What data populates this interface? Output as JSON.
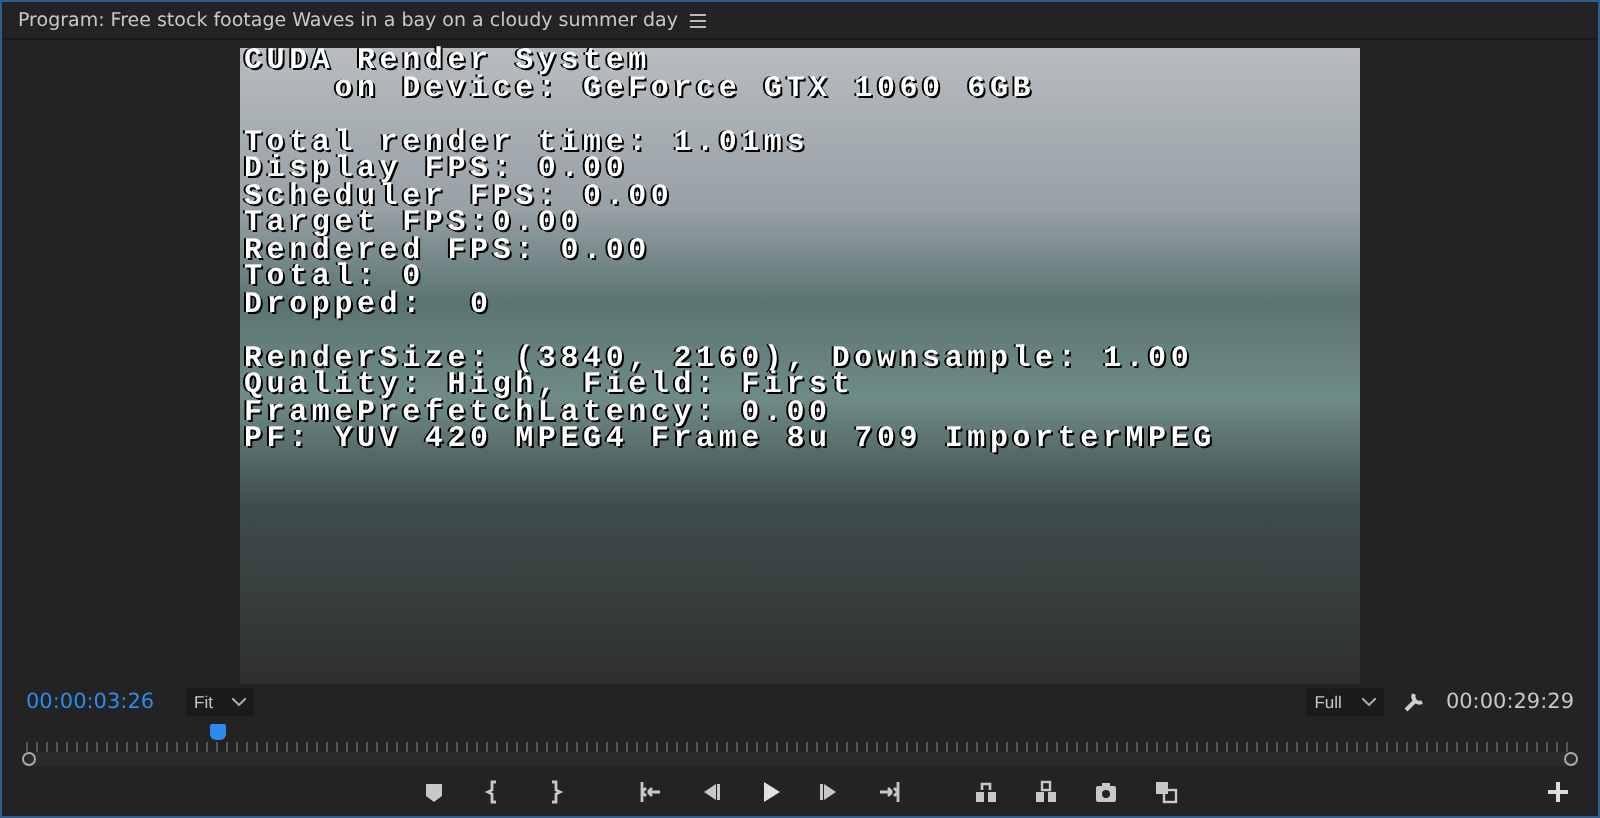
{
  "panel": {
    "title": "Program: Free stock footage Waves in a bay on a cloudy summer day"
  },
  "overlay": {
    "groups": [
      [
        "CUDA Render System",
        "    on Device: GeForce GTX 1060 6GB"
      ],
      [
        "Total render time: 1.01ms",
        "Display FPS: 0.00",
        "Scheduler FPS: 0.00",
        "Target FPS:0.00",
        "Rendered FPS: 0.00",
        "Total: 0",
        "Dropped:  0"
      ],
      [
        "RenderSize: (3840, 2160), Downsample: 1.00",
        "Quality: High, Field: First",
        "FramePrefetchLatency: 0.00",
        "PF: YUV 420 MPEG4 Frame 8u 709 ImporterMPEG"
      ]
    ]
  },
  "current_time": "00:00:03:26",
  "zoom": "Fit",
  "resolution": "Full",
  "duration": "00:00:29:29",
  "timeline": {
    "level": 0.124
  },
  "transport": [
    {
      "kind": "marker"
    },
    {
      "kind": "mark-in"
    },
    {
      "kind": "mark-out"
    },
    {
      "kind": "go-to-in"
    },
    {
      "kind": "step-back"
    },
    {
      "kind": "play"
    },
    {
      "kind": "step-forward"
    },
    {
      "kind": "go-to-out"
    },
    {
      "kind": "insert"
    },
    {
      "kind": "overwrite"
    },
    {
      "kind": "export-frame"
    },
    {
      "kind": "comparison-view"
    }
  ]
}
